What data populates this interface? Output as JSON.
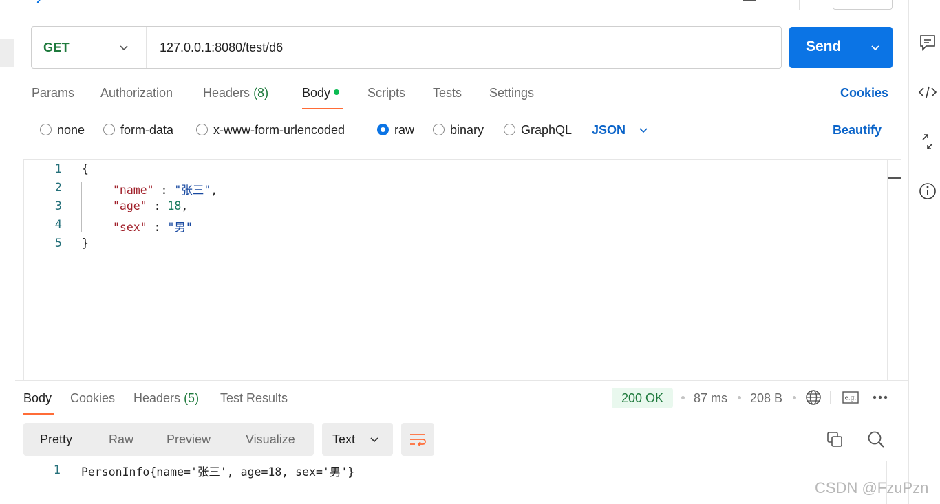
{
  "request": {
    "method": "GET",
    "url": "127.0.0.1:8080/test/d6",
    "send_label": "Send",
    "tabs": [
      {
        "label": "Params"
      },
      {
        "label": "Authorization"
      },
      {
        "label": "Headers",
        "count": "(8)"
      },
      {
        "label": "Body",
        "active": true
      },
      {
        "label": "Scripts"
      },
      {
        "label": "Tests"
      },
      {
        "label": "Settings"
      }
    ],
    "cookies_label": "Cookies",
    "body_types": [
      {
        "label": "none"
      },
      {
        "label": "form-data"
      },
      {
        "label": "x-www-form-urlencoded"
      },
      {
        "label": "raw",
        "selected": true
      },
      {
        "label": "binary"
      },
      {
        "label": "GraphQL"
      }
    ],
    "format": "JSON",
    "beautify_label": "Beautify",
    "body_lines": [
      {
        "n": "1",
        "text": "{"
      },
      {
        "n": "2",
        "text": "\"name\" : \"张三\","
      },
      {
        "n": "3",
        "text": "\"age\" : 18,"
      },
      {
        "n": "4",
        "text": "\"sex\" : \"男\""
      },
      {
        "n": "5",
        "text": "}"
      }
    ]
  },
  "response": {
    "tabs": [
      {
        "label": "Body",
        "active": true
      },
      {
        "label": "Cookies"
      },
      {
        "label": "Headers",
        "count": "(5)"
      },
      {
        "label": "Test Results"
      }
    ],
    "status": "200 OK",
    "time": "87 ms",
    "size": "208 B",
    "view_modes": [
      "Pretty",
      "Raw",
      "Preview",
      "Visualize"
    ],
    "active_view": "Pretty",
    "text_format": "Text",
    "lines": [
      {
        "n": "1",
        "text": "PersonInfo{name='张三', age=18, sex='男'}"
      }
    ]
  },
  "watermark": "CSDN @FzuPzn",
  "colors": {
    "accent": "#0b74e5",
    "tab_indicator": "#ff6c37",
    "success": "#1f7a3d",
    "link": "#0b64c9"
  }
}
